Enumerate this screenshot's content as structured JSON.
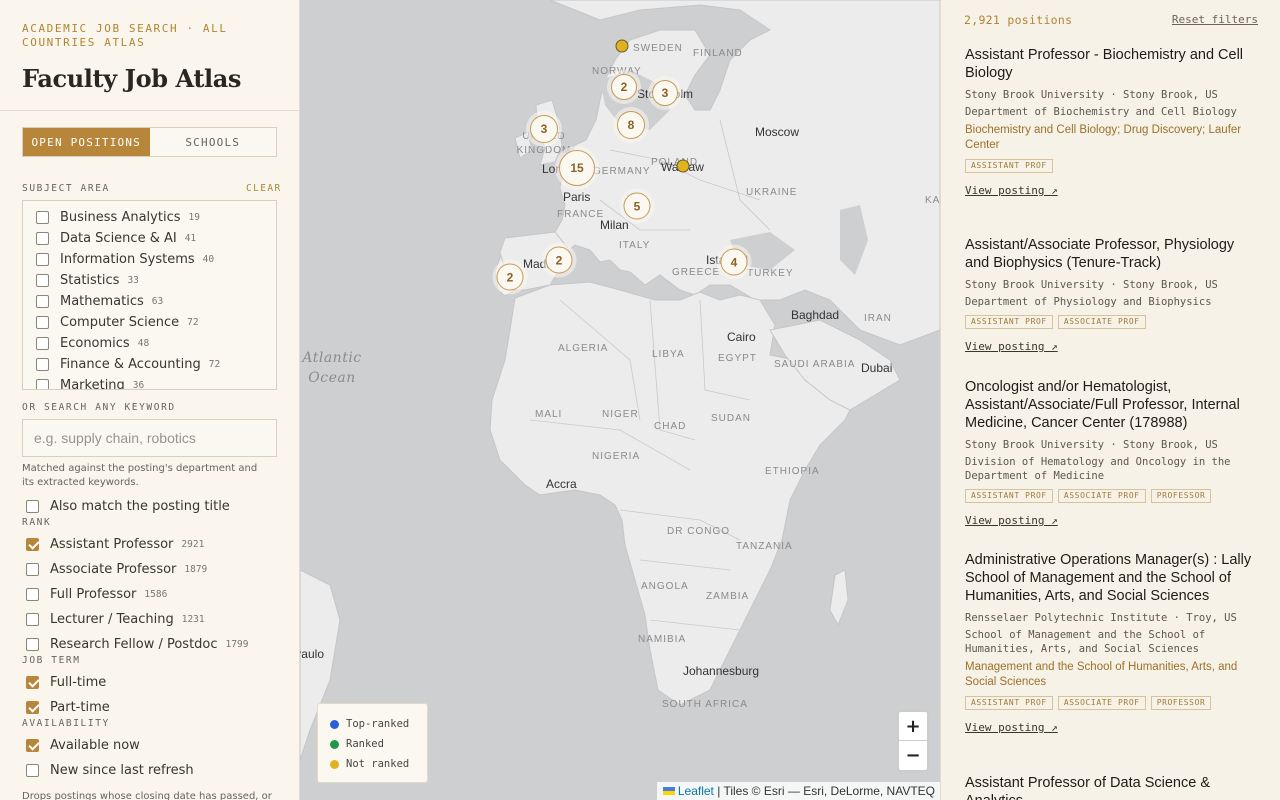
{
  "app": {
    "eyebrow": "ACADEMIC JOB SEARCH · ALL COUNTRIES ATLAS",
    "title": "Faculty Job Atlas"
  },
  "mode_toggle": {
    "open_positions": "OPEN POSITIONS",
    "schools": "SCHOOLS",
    "active": "open_positions"
  },
  "subject_area": {
    "label": "SUBJECT AREA",
    "clear_label": "CLEAR",
    "items": [
      {
        "label": "Business Analytics",
        "count": "19",
        "checked": false
      },
      {
        "label": "Data Science & AI",
        "count": "41",
        "checked": false
      },
      {
        "label": "Information Systems",
        "count": "40",
        "checked": false
      },
      {
        "label": "Statistics",
        "count": "33",
        "checked": false
      },
      {
        "label": "Mathematics",
        "count": "63",
        "checked": false
      },
      {
        "label": "Computer Science",
        "count": "72",
        "checked": false
      },
      {
        "label": "Economics",
        "count": "48",
        "checked": false
      },
      {
        "label": "Finance & Accounting",
        "count": "72",
        "checked": false
      },
      {
        "label": "Marketing",
        "count": "36",
        "checked": false
      }
    ]
  },
  "keyword": {
    "label": "OR SEARCH ANY KEYWORD",
    "placeholder": "e.g. supply chain, robotics",
    "value": "",
    "help": "Matched against the posting's department and its extracted keywords.",
    "match_title_label": "Also match the posting title",
    "match_title_checked": false
  },
  "rank": {
    "label": "RANK",
    "items": [
      {
        "label": "Assistant Professor",
        "count": "2921",
        "checked": true
      },
      {
        "label": "Associate Professor",
        "count": "1879",
        "checked": false
      },
      {
        "label": "Full Professor",
        "count": "1586",
        "checked": false
      },
      {
        "label": "Lecturer / Teaching",
        "count": "1231",
        "checked": false
      },
      {
        "label": "Research Fellow / Postdoc",
        "count": "1799",
        "checked": false
      }
    ]
  },
  "job_term": {
    "label": "JOB TERM",
    "items": [
      {
        "label": "Full-time",
        "checked": true
      },
      {
        "label": "Part-time",
        "checked": true
      }
    ]
  },
  "availability": {
    "label": "AVAILABILITY",
    "items": [
      {
        "label": "Available now",
        "checked": true
      },
      {
        "label": "New since last refresh",
        "checked": false
      }
    ],
    "note": "Drops postings whose closing date has passed, or"
  },
  "map": {
    "cities": [
      "Stockholm",
      "Moscow",
      "London",
      "Warsaw",
      "Paris",
      "Milan",
      "Madrid",
      "Istanbul",
      "Baghdad",
      "Cairo",
      "Dubai",
      "Accra",
      "Johannesburg",
      "São Paulo"
    ],
    "countries": [
      "SWEDEN",
      "FINLAND",
      "NORWAY",
      "UNITED KINGDOM",
      "POLAND",
      "GERMANY",
      "UKRAINE",
      "FRANCE",
      "ITALY",
      "GREECE",
      "TURKEY",
      "KAZ",
      "IRAN",
      "ALGERIA",
      "LIBYA",
      "EGYPT",
      "SAUDI ARABIA",
      "MALI",
      "NIGER",
      "CHAD",
      "SUDAN",
      "NIGERIA",
      "ETHIOPIA",
      "DR CONGO",
      "TANZANIA",
      "ANGOLA",
      "ZAMBIA",
      "NAMIBIA",
      "SOUTH AFRICA"
    ],
    "ocean": "Atlantic Ocean",
    "clusters": [
      "2",
      "3",
      "8",
      "3",
      "15",
      "5",
      "2",
      "2",
      "4"
    ],
    "pins": [
      {
        "name": "pin-norway",
        "status": "Not ranked"
      },
      {
        "name": "pin-warsaw",
        "status": "Not ranked"
      }
    ],
    "legend": [
      {
        "label": "Top-ranked",
        "color": "#2b5fd9"
      },
      {
        "label": "Ranked",
        "color": "#1e9a4a"
      },
      {
        "label": "Not ranked",
        "color": "#e0b21f"
      }
    ],
    "zoom_in": "+",
    "zoom_out": "−",
    "attribution_leaflet": "Leaflet",
    "attribution_tiles": "| Tiles © Esri — Esri, DeLorme, NAVTEQ"
  },
  "results": {
    "count_label": "2,921 positions",
    "reset_label": "Reset filters",
    "view_label": "View posting ↗",
    "jobs": [
      {
        "title": "Assistant Professor - Biochemistry and Cell Biology",
        "meta": "Stony Brook University · Stony Brook, US",
        "dept": "Department of Biochemistry and Cell Biology",
        "keywords": "Biochemistry and Cell Biology; Drug Discovery; Laufer Center",
        "tags": [
          "ASSISTANT PROF"
        ]
      },
      {
        "title": "Assistant/Associate Professor, Physiology and Biophysics (Tenure-Track)",
        "meta": "Stony Brook University · Stony Brook, US",
        "dept": "Department of Physiology and Biophysics",
        "keywords": "",
        "tags": [
          "ASSISTANT PROF",
          "ASSOCIATE PROF"
        ]
      },
      {
        "title": "Oncologist and/or Hematologist, Assistant/Associate/Full Professor, Internal Medicine, Cancer Center (178988)",
        "meta": "Stony Brook University · Stony Brook, US",
        "dept": "Division of Hematology and Oncology in the Department of Medicine",
        "keywords": "",
        "tags": [
          "ASSISTANT PROF",
          "ASSOCIATE PROF",
          "PROFESSOR"
        ]
      },
      {
        "title": "Administrative Operations Manager(s) : Lally School of Management and the School of Humanities, Arts, and Social Sciences",
        "meta": "Rensselaer Polytechnic Institute · Troy, US",
        "dept": "School of Management and the School of Humanities, Arts, and Social Sciences",
        "keywords": "Management and the School of Humanities, Arts, and Social Sciences",
        "tags": [
          "ASSISTANT PROF",
          "ASSOCIATE PROF",
          "PROFESSOR"
        ]
      },
      {
        "title": "Assistant Professor of Data Science & Analytics",
        "meta": "",
        "dept": "",
        "keywords": "",
        "tags": []
      }
    ]
  }
}
